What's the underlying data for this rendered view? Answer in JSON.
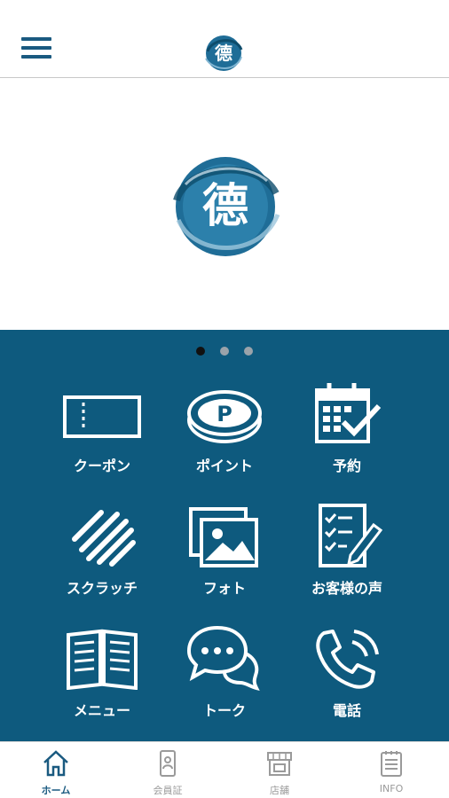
{
  "header": {
    "menu_icon": "hamburger-icon",
    "logo_text": "德"
  },
  "banner": {
    "logo_text": "德",
    "carousel": {
      "pages": 3,
      "active": 1
    }
  },
  "menu": {
    "items": [
      {
        "label": "クーポン",
        "icon": "coupon-icon"
      },
      {
        "label": "ポイント",
        "icon": "point-icon"
      },
      {
        "label": "予約",
        "icon": "reservation-icon"
      },
      {
        "label": "スクラッチ",
        "icon": "scratch-icon"
      },
      {
        "label": "フォト",
        "icon": "photo-icon"
      },
      {
        "label": "お客様の声",
        "icon": "customer-voice-icon"
      },
      {
        "label": "メニュー",
        "icon": "menu-book-icon"
      },
      {
        "label": "トーク",
        "icon": "talk-icon"
      },
      {
        "label": "電話",
        "icon": "phone-icon"
      }
    ]
  },
  "tabbar": {
    "items": [
      {
        "label": "ホーム",
        "icon": "home-icon",
        "active": true
      },
      {
        "label": "会員証",
        "icon": "member-card-icon",
        "active": false
      },
      {
        "label": "店舗",
        "icon": "store-icon",
        "active": false
      },
      {
        "label": "INFO",
        "icon": "info-icon",
        "active": false
      }
    ]
  },
  "colors": {
    "brand": "#0e5a7e",
    "header_icon": "#1a5a80",
    "tab_inactive": "#9a9a9a"
  }
}
